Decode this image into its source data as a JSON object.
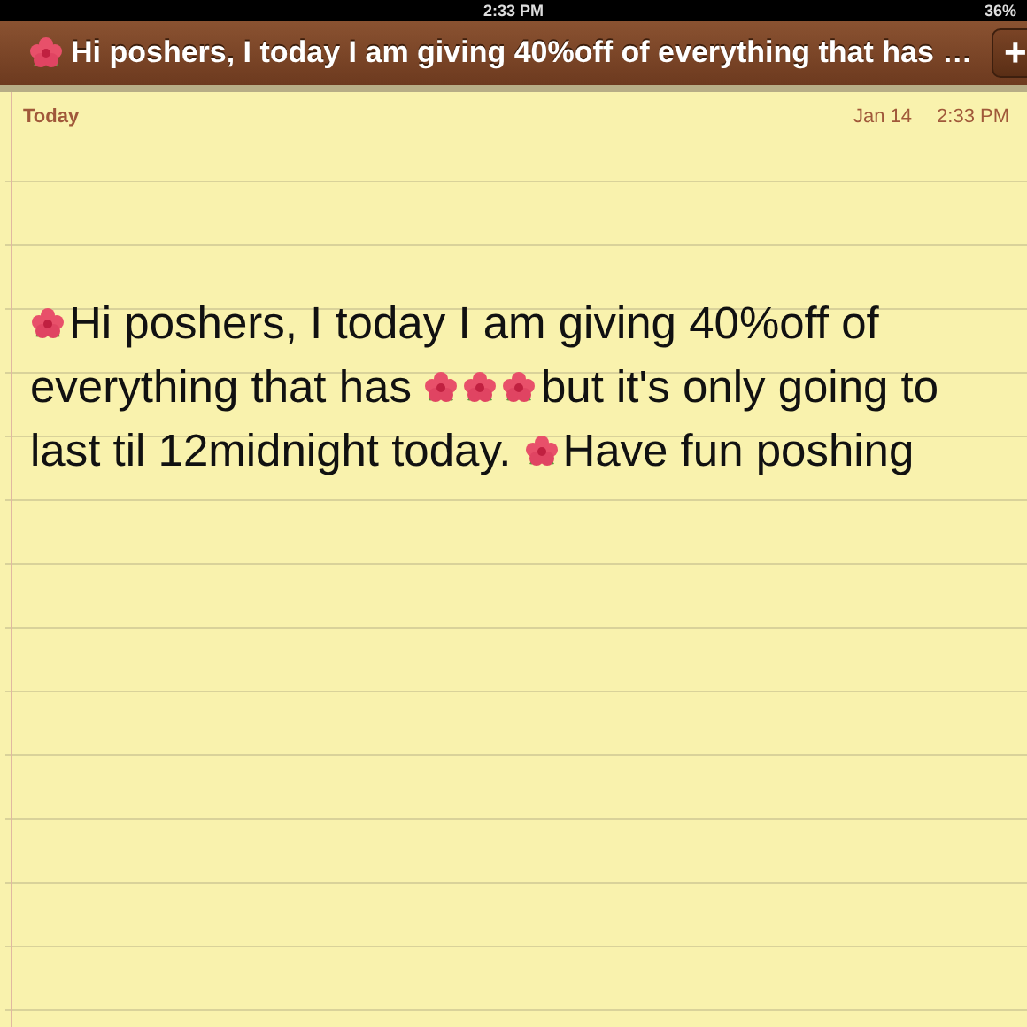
{
  "status_bar": {
    "time": "2:33 PM",
    "battery": "36%"
  },
  "title_bar": {
    "title": "Hi poshers, I today I am giving 40%off of everything that has …",
    "add_button": "+"
  },
  "note": {
    "day": "Today",
    "date": "Jan 14",
    "time": "2:33 PM",
    "lines": [
      [
        {
          "kind": "flower"
        },
        {
          "kind": "text",
          "text": "Hi poshers, I today I am giving 40%off of"
        }
      ],
      [
        {
          "kind": "text",
          "text": "everything that has"
        },
        {
          "kind": "flower"
        },
        {
          "kind": "flower"
        },
        {
          "kind": "flower"
        },
        {
          "kind": "text",
          "text": "but it's only going to"
        }
      ],
      [
        {
          "kind": "text",
          "text": "last til 12midnight today."
        },
        {
          "kind": "flower"
        },
        {
          "kind": "text",
          "text": "Have fun poshing"
        }
      ]
    ]
  }
}
